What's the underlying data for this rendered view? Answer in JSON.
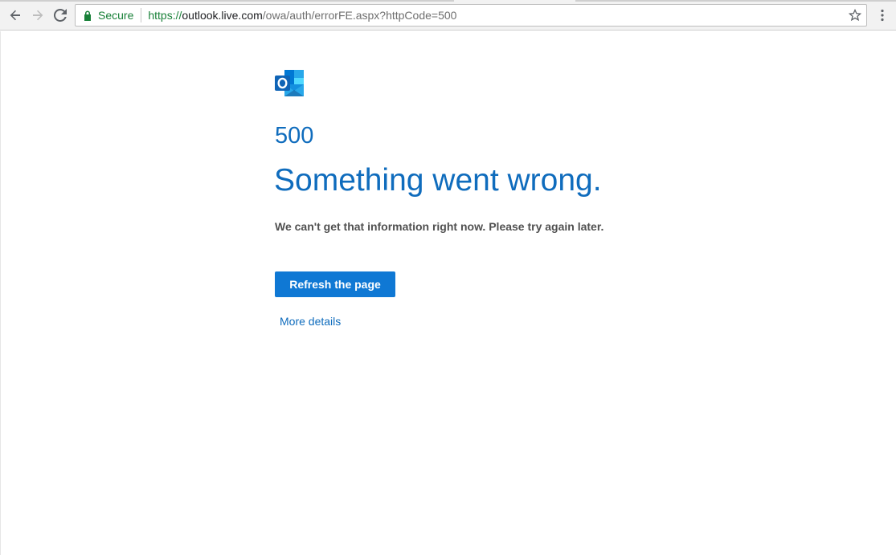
{
  "browser": {
    "secure_label": "Secure",
    "url_scheme": "https://",
    "url_host": "outlook.live.com",
    "url_path": "/owa/auth/errorFE.aspx?httpCode=500",
    "icons": {
      "back": "arrow-left-icon",
      "forward": "arrow-right-icon",
      "reload": "reload-icon",
      "lock": "lock-icon",
      "bookmark": "star-icon",
      "menu": "kebab-menu-icon"
    },
    "colors": {
      "secure": "#188038"
    }
  },
  "page": {
    "logo": "outlook-logo",
    "error_code": "500",
    "headline": "Something went wrong.",
    "message": "We can't get that information right now. Please try again later.",
    "refresh_button": "Refresh the page",
    "more_details_link": "More details",
    "colors": {
      "accent": "#0f6cbd",
      "button": "#0f78d4",
      "text": "#505050"
    }
  }
}
